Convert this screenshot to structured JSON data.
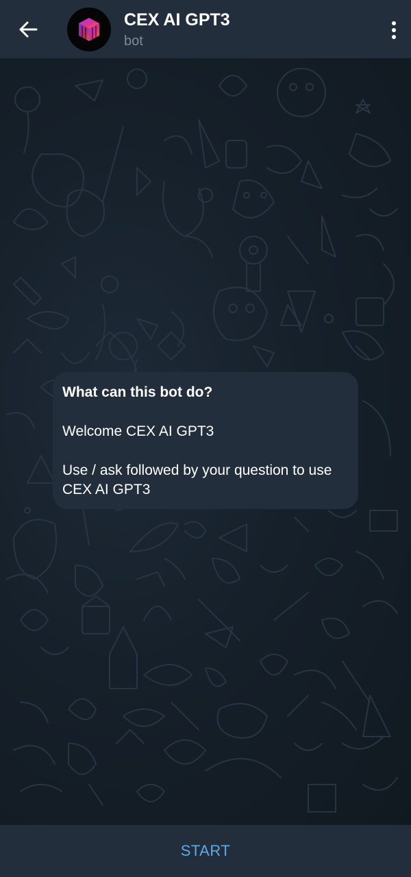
{
  "header": {
    "title": "CEX AI GPT3",
    "subtitle": "bot",
    "back_icon": "arrow-left-icon",
    "menu_icon": "more-vertical-icon",
    "avatar_icon": "cube-logo-icon"
  },
  "intro": {
    "heading": "What can this bot do?",
    "welcome": "Welcome CEX AI GPT3",
    "usage": "Use / ask followed by your question to use CEX AI GPT3"
  },
  "bottom": {
    "start_label": "START"
  },
  "colors": {
    "header_bg": "#232e3c",
    "chat_bg": "#151e27",
    "bubble_bg": "#232e3c",
    "accent": "#5fa9e6",
    "subtitle": "#7d8b99"
  }
}
